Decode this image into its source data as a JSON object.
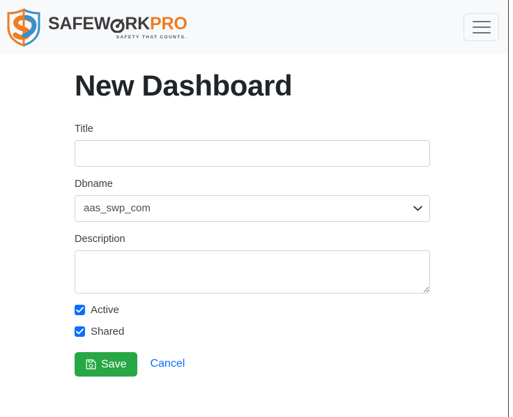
{
  "navbar": {
    "brand": {
      "logo_icon": "shield-logo-icon",
      "name_part1": "SAFEW",
      "name_part1b": "RK",
      "name_part2": "PRO",
      "tagline": "SAFETY THAT COUNTS.",
      "colors": {
        "orange": "#f07c24",
        "blue": "#3b90c6",
        "dark": "#3d3d3f"
      }
    },
    "toggler": {
      "icon": "hamburger-icon",
      "label": "Toggle navigation"
    }
  },
  "main": {
    "title": "New Dashboard",
    "fields": {
      "title": {
        "label": "Title",
        "value": "",
        "placeholder": ""
      },
      "dbname": {
        "label": "Dbname",
        "value": "aas_swp_com",
        "options": [
          "aas_swp_com"
        ],
        "chevron_icon": "chevron-down-icon"
      },
      "description": {
        "label": "Description",
        "value": "",
        "placeholder": ""
      }
    },
    "checkboxes": [
      {
        "label": "Active",
        "checked": true
      },
      {
        "label": "Shared",
        "checked": true
      }
    ],
    "actions": {
      "save_label": "Save",
      "save_icon": "floppy-disk-save-icon",
      "save_color": "#28a745",
      "cancel_label": "Cancel",
      "cancel_color": "#0d6efd"
    }
  }
}
